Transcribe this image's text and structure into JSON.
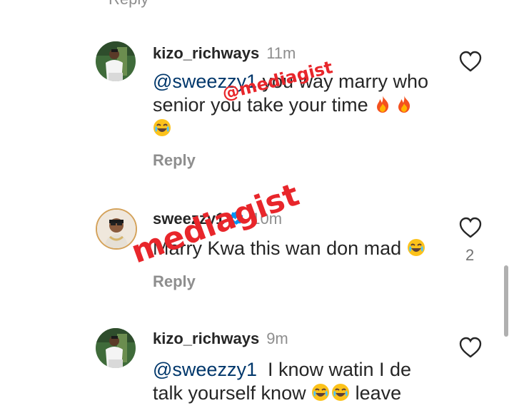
{
  "top_partial": {
    "reply_label": "Reply"
  },
  "comments": [
    {
      "username": "kizo_richways",
      "time": "11m",
      "mention": "@sweezzy1",
      "text_1": " you way marry who",
      "text_2": "senior you take your time",
      "emojis_line2": [
        "fire-emoji",
        "fire-emoji"
      ],
      "emojis_line3": [
        "laughing-emoji"
      ],
      "reply_label": "Reply",
      "likes": ""
    },
    {
      "username": "sweezzy1",
      "verified": true,
      "time": "10m",
      "text_1": "Marry Kwa this wan don mad",
      "emojis_line1": [
        "laughing-emoji"
      ],
      "reply_label": "Reply",
      "likes": "2"
    },
    {
      "username": "kizo_richways",
      "time": "9m",
      "mention": "@sweezzy1",
      "text_1": "  I know watin I de",
      "text_2": "talk yourself know",
      "text_2_tail": " leave",
      "emojis_line2": [
        "laughing-emoji",
        "laughing-emoji"
      ]
    }
  ],
  "watermarks": [
    "@mediagist",
    "mediagist"
  ],
  "colors": {
    "text": "#262626",
    "secondary": "#8e8e8e",
    "mention": "#00376b",
    "verified": "#0095f6",
    "watermark": "#e8262b"
  }
}
